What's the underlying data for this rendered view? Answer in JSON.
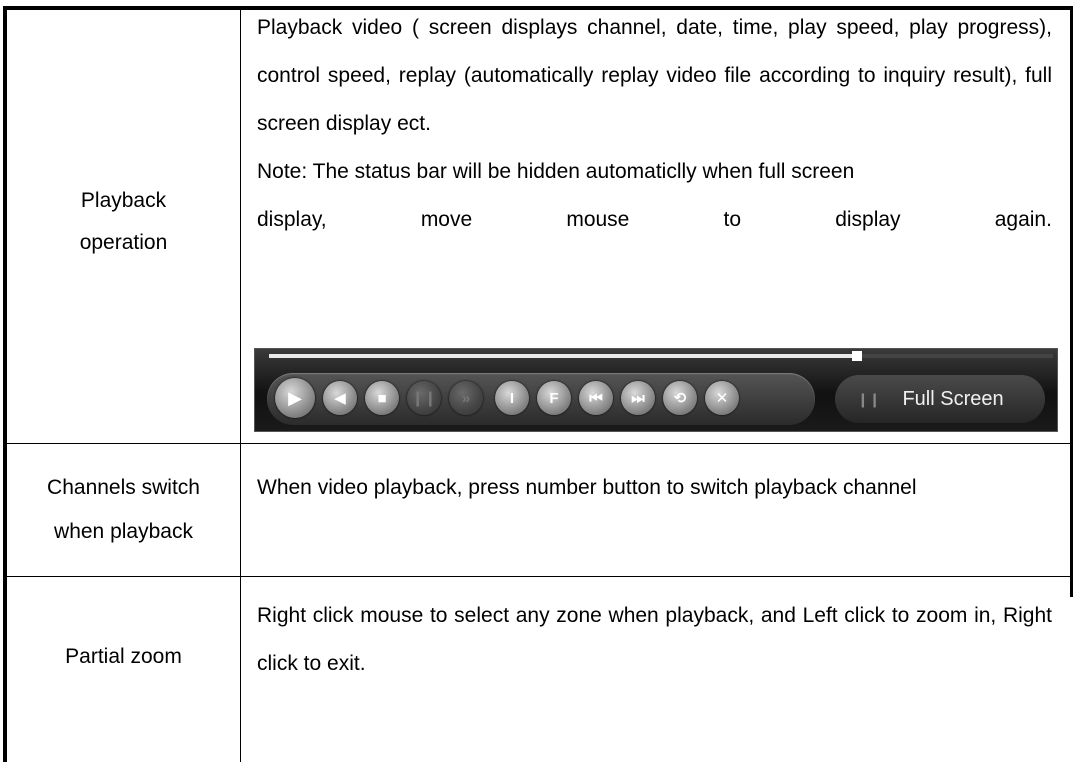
{
  "table": {
    "rows": [
      {
        "label_lines": [
          "Playback",
          "operation"
        ],
        "description": "Playback video ( screen displays channel, date, time, play speed, play progress), control speed, replay (automatically replay video file according to inquiry result), full screen display ect.",
        "note_line1": "Note: The status bar will be hidden automaticlly when full screen",
        "note_words": [
          "display,",
          "move",
          "mouse",
          "to",
          "display",
          "again."
        ]
      },
      {
        "label_lines": [
          "Channels switch",
          "when playback"
        ],
        "description": "When video playback, press number button to switch playback channel"
      },
      {
        "label_lines": [
          "Partial zoom"
        ],
        "description": "Right click mouse to select any zone when playback, and Left click to zoom in, Right click to exit."
      }
    ]
  },
  "playbar": {
    "progress_fraction": 0.75,
    "buttons": [
      {
        "icon": "play-icon",
        "glyph": "▶"
      },
      {
        "icon": "reverse-play-icon",
        "glyph": "◀"
      },
      {
        "icon": "stop-icon",
        "glyph": "■"
      },
      {
        "icon": "pause-icon",
        "glyph": "❙❙"
      },
      {
        "icon": "fast-forward-icon",
        "glyph": "»"
      },
      {
        "icon": "slow-icon",
        "glyph": "I"
      },
      {
        "icon": "fast-icon",
        "glyph": "F"
      },
      {
        "icon": "previous-file-icon",
        "glyph": "⏮"
      },
      {
        "icon": "next-file-icon",
        "glyph": "⏭"
      },
      {
        "icon": "replay-icon",
        "glyph": "⟲"
      },
      {
        "icon": "fullscreen-toggle-icon",
        "glyph": "✕"
      }
    ],
    "fullscreen_separator": "❙❙",
    "fullscreen_label": "Full Screen"
  }
}
